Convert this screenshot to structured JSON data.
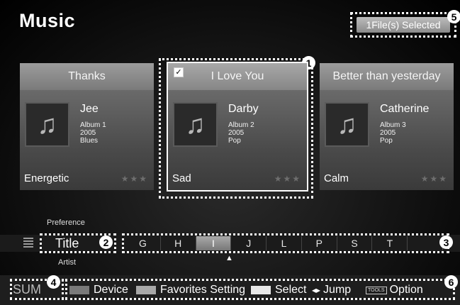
{
  "header": {
    "title": "Music",
    "selected_text": "1File(s) Selected"
  },
  "callouts": [
    "1",
    "2",
    "3",
    "4",
    "5",
    "6"
  ],
  "cards": [
    {
      "title": "Thanks",
      "artist": "Jee",
      "album": "Album 1",
      "year": "2005",
      "genre": "Blues",
      "mood": "Energetic",
      "stars": "★★★",
      "checked": false
    },
    {
      "title": "I Love You",
      "artist": "Darby",
      "album": "Album 2",
      "year": "2005",
      "genre": "Pop",
      "mood": "Sad",
      "stars": "★★★",
      "checked": true,
      "check_glyph": "✓"
    },
    {
      "title": "Better than yesterday",
      "artist": "Catherine",
      "album": "Album 3",
      "year": "2005",
      "genre": "Pop",
      "mood": "Calm",
      "stars": "★★★",
      "checked": false
    }
  ],
  "sort": {
    "above": "Preference",
    "current": "Title",
    "below": "Artist"
  },
  "letters": [
    "G",
    "H",
    "I",
    "J",
    "L",
    "P",
    "S",
    "T",
    ""
  ],
  "active_letter": "I",
  "pointer": "▲",
  "footer": {
    "sum": "SUM",
    "device": "Device",
    "favorites": "Favorites Setting",
    "select": "Select",
    "jump_icon": "◂▸",
    "jump": "Jump",
    "tools_icon": "TOOLS",
    "option": "Option"
  },
  "colors": {
    "device_swatch": "#7a7a7a",
    "favorites_swatch": "#a8a8a8",
    "select_swatch": "#e8e8e8"
  },
  "icons": {
    "music_note": "♫"
  }
}
